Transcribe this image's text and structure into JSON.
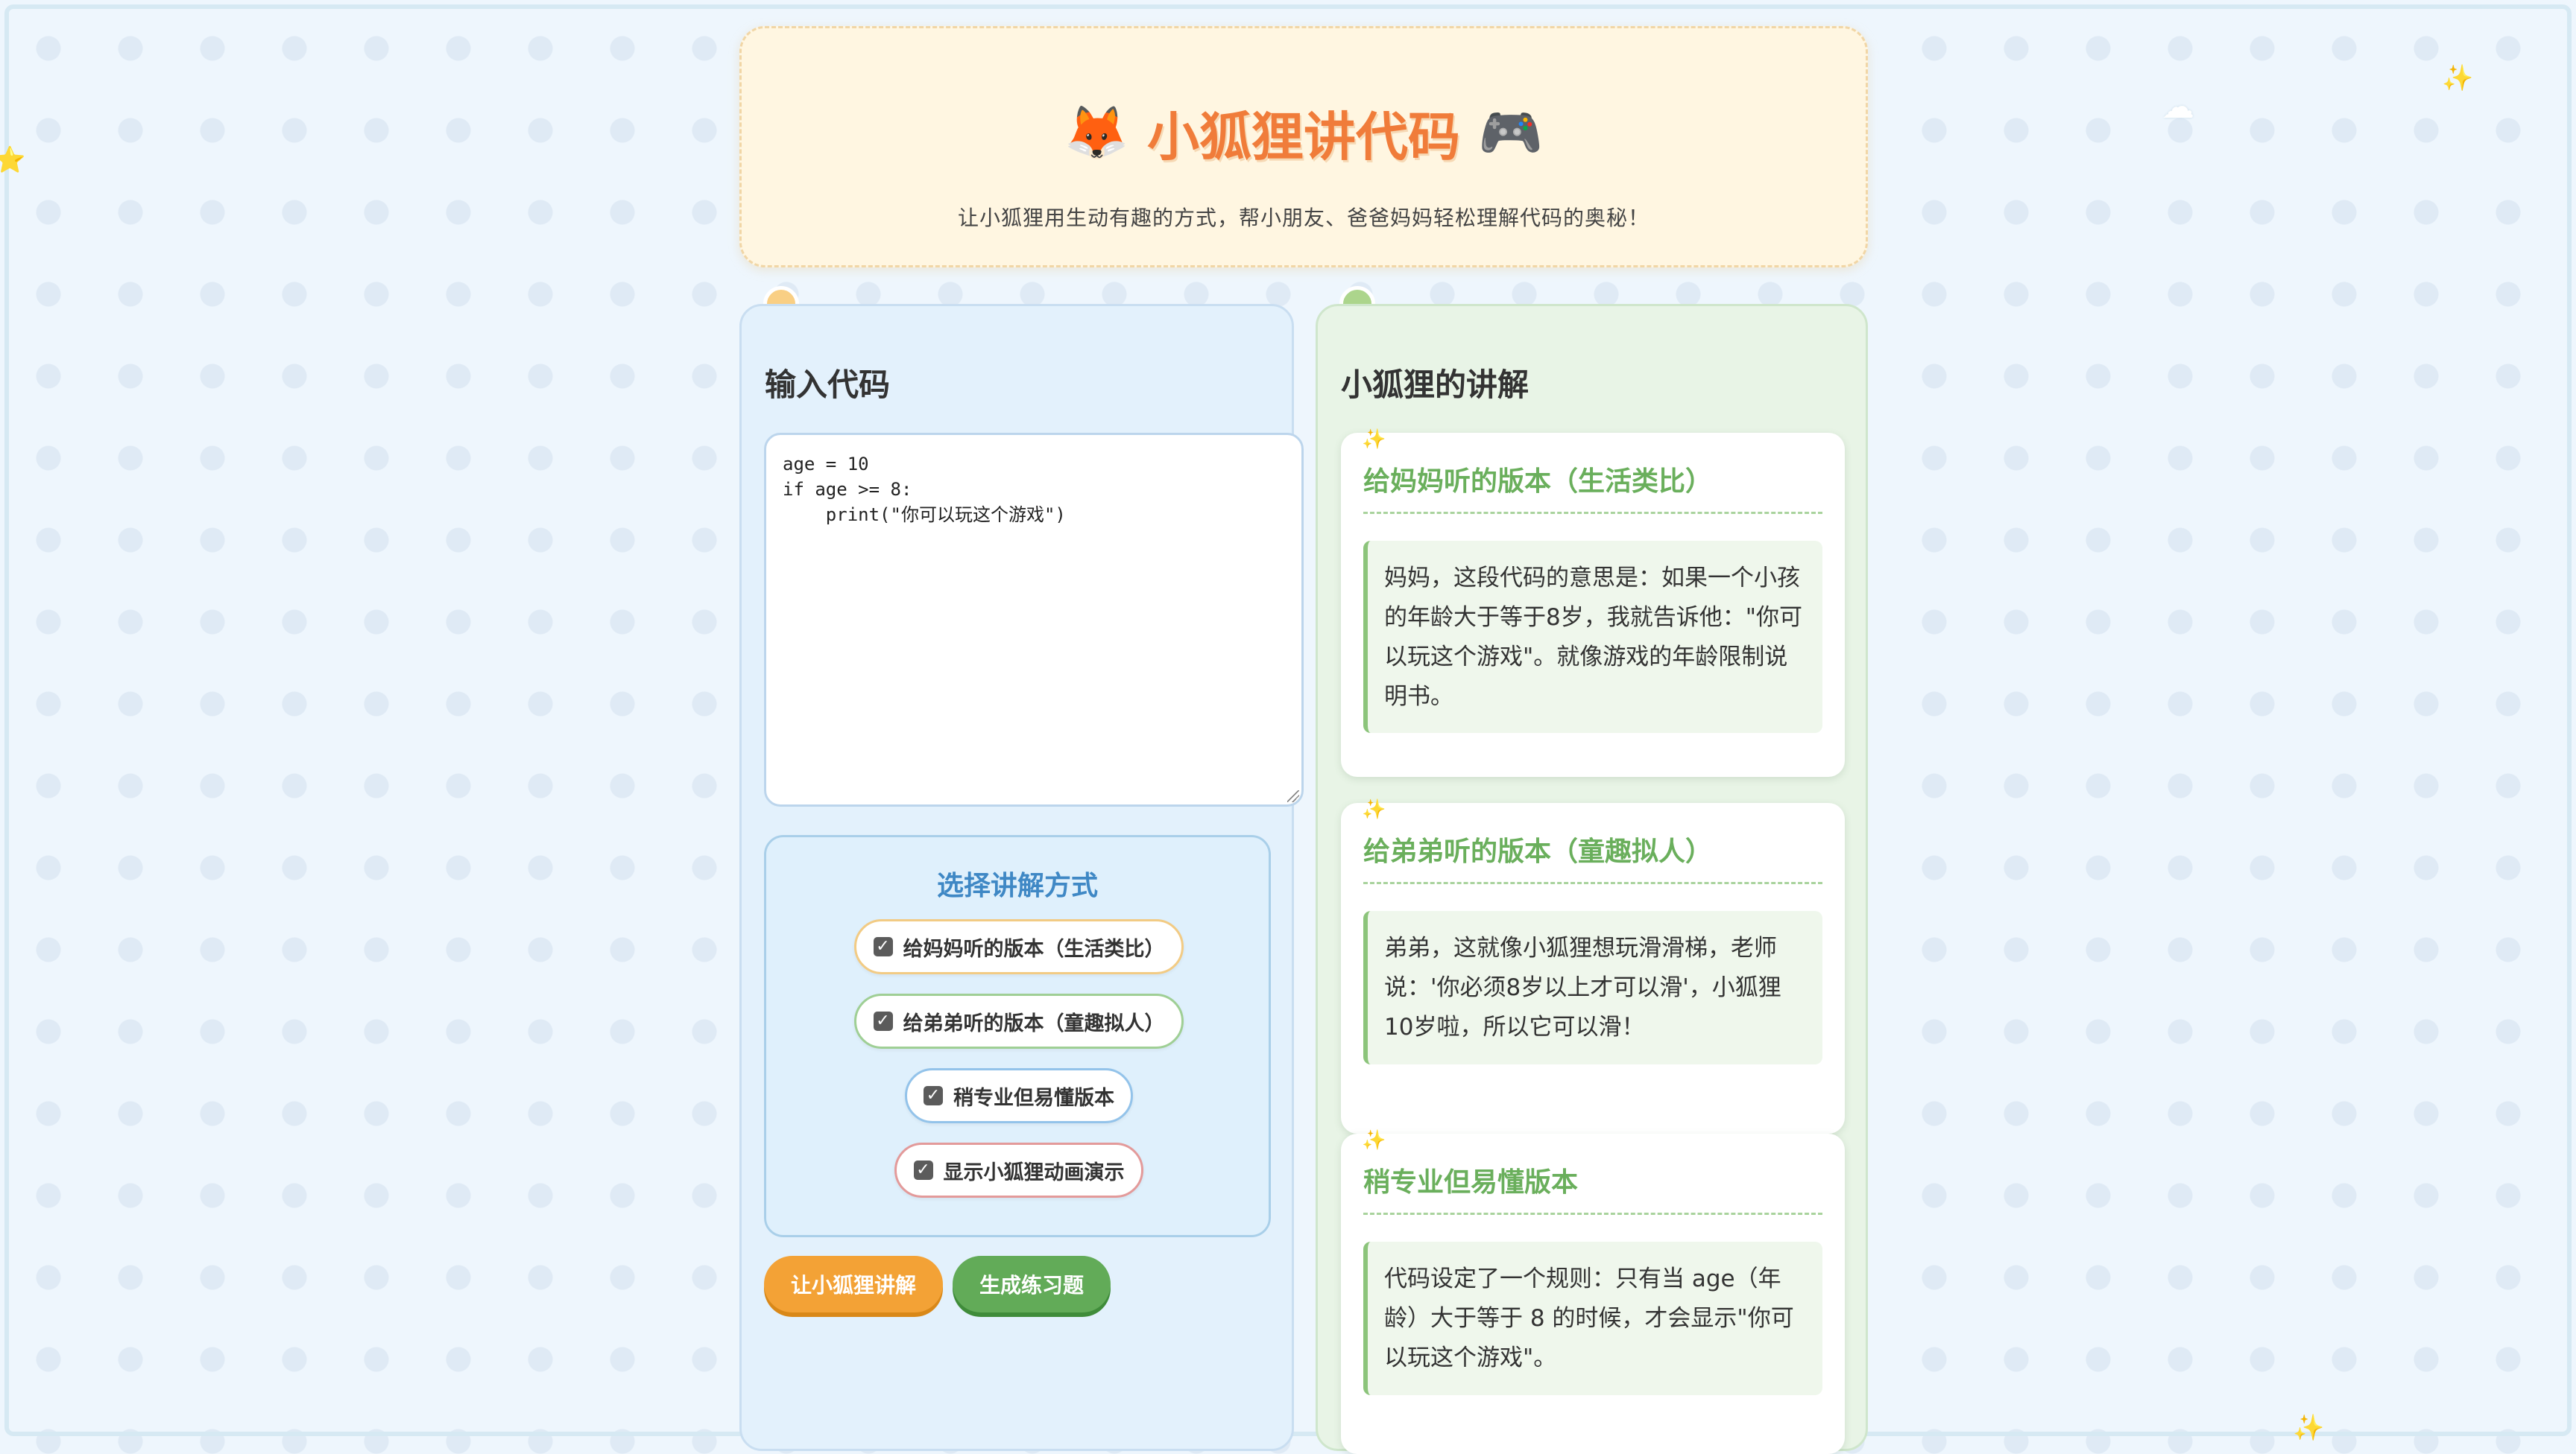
{
  "header": {
    "title_emoji_left": "🦊",
    "title": "小狐狸讲代码",
    "title_emoji_right": "🎮",
    "subtitle": "让小狐狸用生动有趣的方式，帮小朋友、爸爸妈妈轻松理解代码的奥秘！"
  },
  "input_panel": {
    "title": "输入代码",
    "code": "age = 10\nif age >= 8:\n    print(\"你可以玩这个游戏\")",
    "options_title": "选择讲解方式",
    "options": [
      {
        "label": "给妈妈听的版本（生活类比）",
        "checked": true
      },
      {
        "label": "给弟弟听的版本（童趣拟人）",
        "checked": true
      },
      {
        "label": "稍专业但易懂版本",
        "checked": true
      },
      {
        "label": "显示小狐狸动画演示",
        "checked": true
      }
    ],
    "checkbox_mark": "✓",
    "buttons": {
      "explain": "让小狐狸讲解",
      "practice": "生成练习题"
    }
  },
  "explain_panel": {
    "title": "小狐狸的讲解",
    "sparkle": "✨",
    "cards": [
      {
        "title": "给妈妈听的版本（生活类比）",
        "body": "妈妈，这段代码的意思是：如果一个小孩的年龄大于等于8岁，我就告诉他：\"你可以玩这个游戏\"。就像游戏的年龄限制说明书。"
      },
      {
        "title": "给弟弟听的版本（童趣拟人）",
        "body": "弟弟，这就像小狐狸想玩滑滑梯，老师说：'你必须8岁以上才可以滑'，小狐狸10岁啦，所以它可以滑！"
      },
      {
        "title": "稍专业但易懂版本",
        "body": "代码设定了一个规则：只有当 age（年龄）大于等于 8 的时候，才会显示\"你可以玩这个游戏\"。"
      }
    ]
  },
  "decorations": {
    "sparkle": "✨",
    "star": "⭐",
    "cloud": "☁"
  },
  "colors": {
    "title_orange": "#f07c3a",
    "option_title_blue": "#3f88c5",
    "card_title_green": "#6aaf5c",
    "button_orange": "#f3a236",
    "button_green": "#62ab58"
  }
}
